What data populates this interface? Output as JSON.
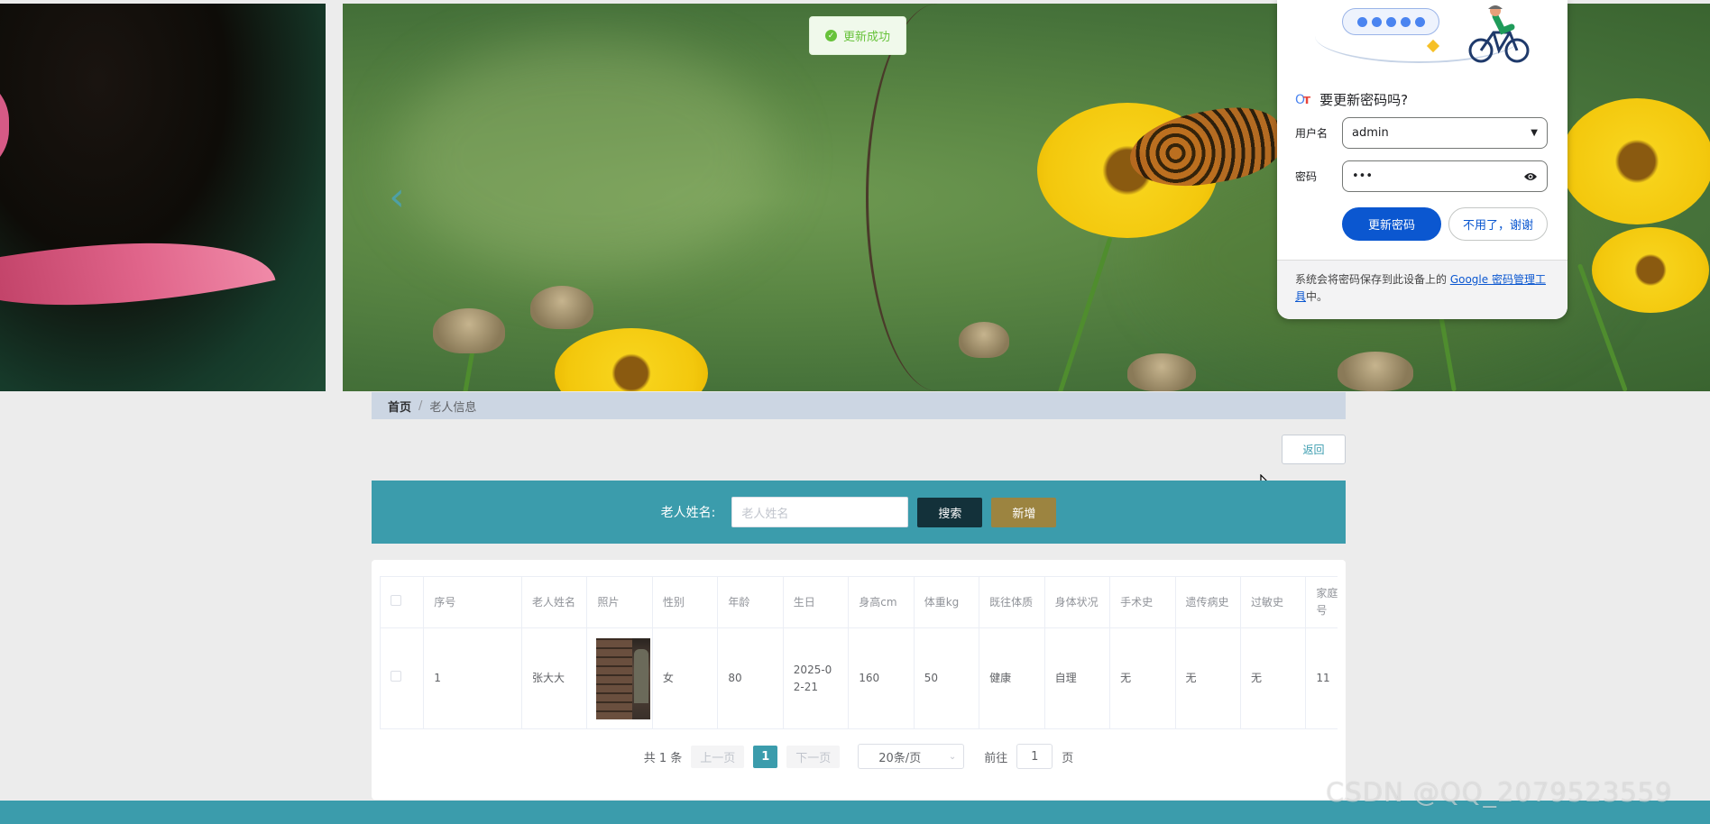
{
  "toast": {
    "message": "更新成功"
  },
  "password_popup": {
    "title": "要更新密码吗?",
    "username_label": "用户名",
    "username_value": "admin",
    "password_label": "密码",
    "password_value": "•••",
    "update_button": "更新密码",
    "dismiss_button": "不用了，谢谢",
    "footer_text": "系统会将密码保存到此设备上的 ",
    "footer_link": "Google 密码管理工具",
    "footer_suffix": "中。"
  },
  "carousel": {
    "prev_icon": "chevron-left-icon"
  },
  "breadcrumb": {
    "home": "首页",
    "separator": "/",
    "current": "老人信息"
  },
  "back_button": "返回",
  "search": {
    "label": "老人姓名:",
    "placeholder": "老人姓名",
    "search_button": "搜索",
    "add_button": "新增"
  },
  "table": {
    "columns": [
      "序号",
      "老人姓名",
      "照片",
      "性别",
      "年龄",
      "生日",
      "身高cm",
      "体重kg",
      "既往体质",
      "身体状况",
      "手术史",
      "遗传病史",
      "过敏史",
      "家庭电话号"
    ],
    "rows": [
      {
        "index": "1",
        "name": "张大大",
        "gender": "女",
        "age": "80",
        "birthday": "2025-02-21",
        "height": "160",
        "weight": "50",
        "constitution": "健康",
        "condition": "自理",
        "surgery": "无",
        "genetic": "无",
        "allergy": "无",
        "phone": "11"
      }
    ]
  },
  "pagination": {
    "total": "共 1 条",
    "prev": "上一页",
    "current_page": "1",
    "next": "下一页",
    "page_size": "20条/页",
    "goto_label": "前往",
    "goto_value": "1",
    "page_suffix": "页"
  },
  "watermark": "CSDN @QQ_2079523559",
  "colors": {
    "accent": "#3b9cac",
    "search_button": "#13313a",
    "add_button": "#9c8440",
    "chrome_blue": "#0b57d0"
  }
}
